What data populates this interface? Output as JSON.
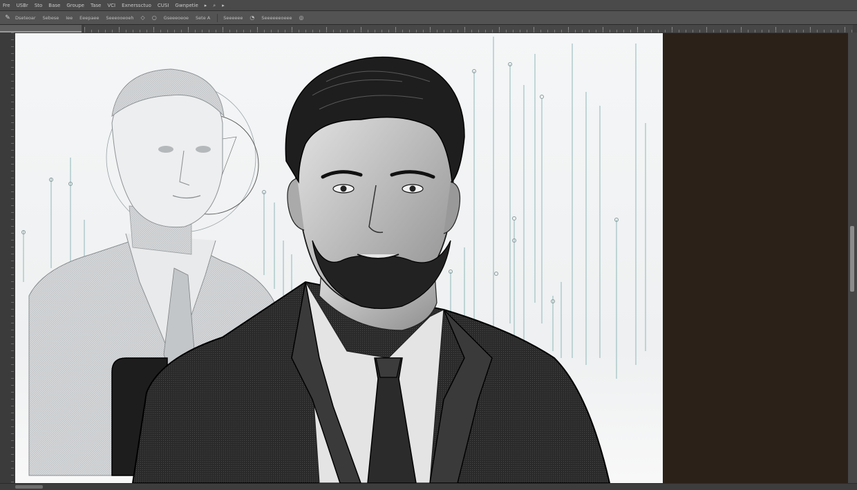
{
  "menu": {
    "items": [
      "Fre",
      "USBr",
      "Sto",
      "Base",
      "Groupe",
      "Tase",
      "VCI",
      "Exnerssctuo",
      "CUSI",
      "Gwnpetie"
    ]
  },
  "options": {
    "tool_icon": "brush-icon",
    "items": [
      "Dseteoar",
      "Sebese",
      "Iee",
      "Eeepaee",
      "Seeeooeoeh",
      "Gseeeoeoe",
      "Sete A",
      "Seeeeee",
      "Seeeeeeoeee"
    ],
    "icons": [
      "chevron-icon",
      "circle-icon",
      "speech-icon",
      "pressure-icon"
    ]
  },
  "colors": {
    "canvas_bg": "#f7f8f9",
    "side_panel": "#2b2118",
    "ui_dark": "#3a3a3a",
    "ui_bar": "#535353"
  }
}
